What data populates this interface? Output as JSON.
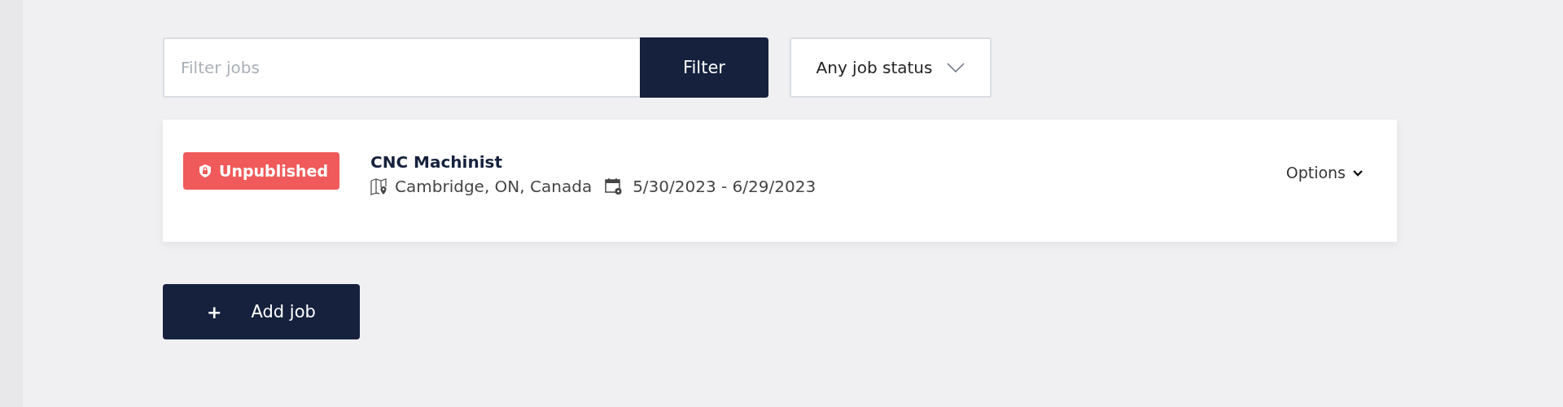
{
  "filter": {
    "placeholder": "Filter jobs",
    "button": "Filter"
  },
  "status_dropdown": {
    "value": "Any job status"
  },
  "jobs": [
    {
      "status": {
        "label": "Unpublished",
        "kind": "unpublished"
      },
      "title": "CNC Machinist",
      "location": "Cambridge, ON, Canada",
      "dates": "5/30/2023 - 6/29/2023",
      "options": "Options"
    }
  ],
  "add_button": {
    "icon": "+",
    "label": "Add job"
  }
}
